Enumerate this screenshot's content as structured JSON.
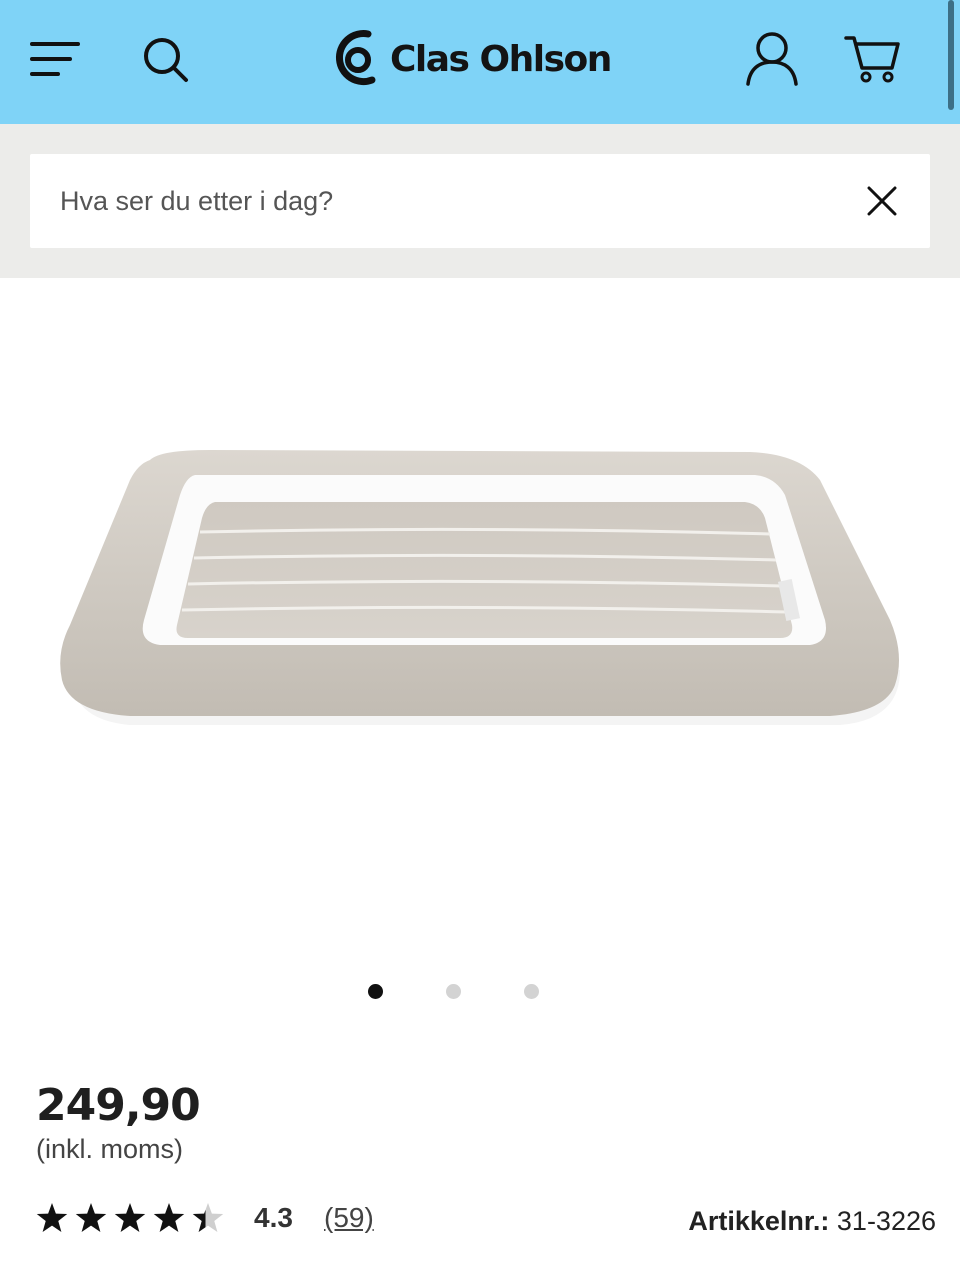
{
  "header": {
    "brand_name": "Clas Ohlson",
    "background_color": "#7fd3f7",
    "icons": [
      "menu-icon",
      "search-icon",
      "user-icon",
      "cart-icon"
    ]
  },
  "search": {
    "placeholder": "Hva ser du etter i dag?",
    "value": ""
  },
  "gallery": {
    "image_count": 3,
    "active_index": 0
  },
  "product": {
    "price": "249,90",
    "price_note": "(inkl. moms)",
    "rating_value": "4.3",
    "rating_stars": 4.3,
    "review_count": "(59)",
    "article_label": "Artikkelnr.:",
    "article_number": "31-3226"
  }
}
